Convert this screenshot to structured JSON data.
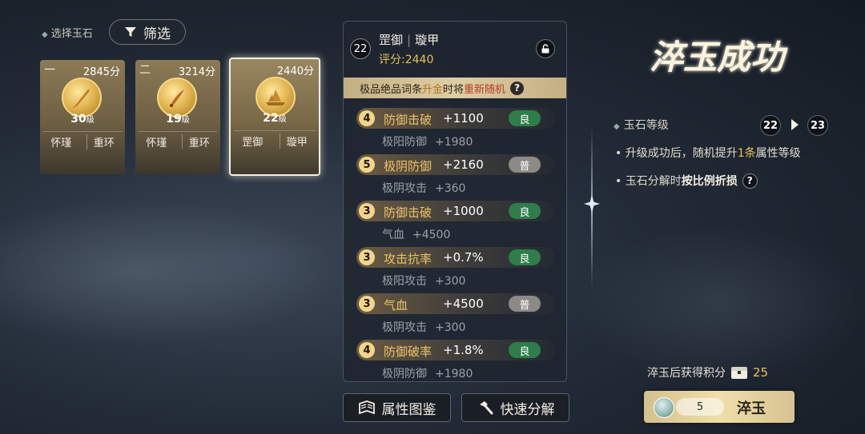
{
  "top": {
    "select_label": "选择玉石",
    "filter_label": "筛选"
  },
  "cards": [
    {
      "rank": "一",
      "score": "2845分",
      "level": "30",
      "level_unit": "级",
      "tag1": "怀瑾",
      "tag2": "重环",
      "selected": false
    },
    {
      "rank": "二",
      "score": "3214分",
      "level": "19",
      "level_unit": "级",
      "tag1": "怀瑾",
      "tag2": "重环",
      "selected": false
    },
    {
      "rank": "",
      "score": "2440分",
      "level": "22",
      "level_unit": "级",
      "tag1": "罡御",
      "tag2": "璇甲",
      "selected": true
    }
  ],
  "panel": {
    "level": "22",
    "name1": "罡御",
    "separator": "|",
    "name2": "璇甲",
    "score": "评分:2440",
    "banner_pre": "极品绝品词条",
    "banner_hl": "升金",
    "banner_mid": "时将",
    "banner_red": "重新随机",
    "help": "?",
    "attributes": [
      {
        "num": "4",
        "name": "防御击破",
        "value": "+1100",
        "grade": "良",
        "grade_type": "good",
        "sub_name": "极阳防御",
        "sub_value": "+1980"
      },
      {
        "num": "5",
        "name": "极阴防御",
        "value": "+2160",
        "grade": "普",
        "grade_type": "norm",
        "sub_name": "极阴攻击",
        "sub_value": "+360"
      },
      {
        "num": "3",
        "name": "防御击破",
        "value": "+1000",
        "grade": "良",
        "grade_type": "good",
        "sub_name": "气血",
        "sub_value": "+4500"
      },
      {
        "num": "3",
        "name": "攻击抗率",
        "value": "+0.7%",
        "grade": "良",
        "grade_type": "good",
        "sub_name": "极阳攻击",
        "sub_value": "+300"
      },
      {
        "num": "3",
        "name": "气血",
        "value": "+4500",
        "grade": "普",
        "grade_type": "norm",
        "sub_name": "极阴攻击",
        "sub_value": "+300"
      },
      {
        "num": "4",
        "name": "防御破率",
        "value": "+1.8%",
        "grade": "良",
        "grade_type": "good",
        "sub_name": "极阴防御",
        "sub_value": "+1980"
      }
    ]
  },
  "buttons": {
    "codex": "属性图鉴",
    "quick_decompose": "快速分解"
  },
  "result": {
    "title": "淬玉成功",
    "level_label": "玉石等级",
    "level_from": "22",
    "level_to": "23",
    "line1_pre": "• 升级成功后，随机提升",
    "line1_hl": "1条",
    "line1_post": "属性等级",
    "line2_pre": "• 玉石分解时",
    "line2_hl": "按比例折损",
    "earn_label": "淬玉后获得积分",
    "earn_value": "25",
    "cuiyu_count": "5",
    "cuiyu_label": "淬玉"
  },
  "colors": {
    "accent_gold": "#e8c15a",
    "grade_good": "#2e7d4a",
    "grade_norm": "#8d8a86"
  }
}
